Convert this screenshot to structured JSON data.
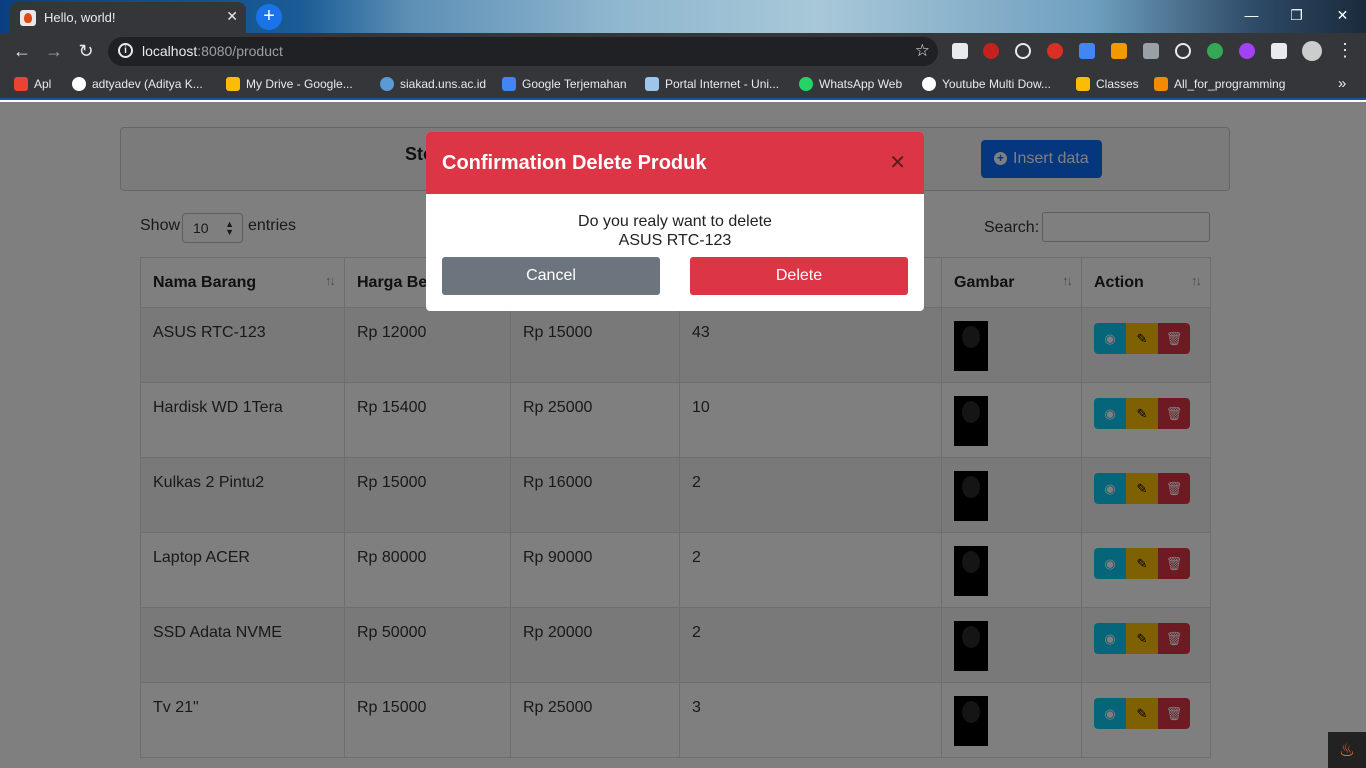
{
  "browser": {
    "tab_title": "Hello, world!",
    "tab_close": "✕",
    "new_tab": "+",
    "url_host": "localhost",
    "url_rest": ":8080/product",
    "win_min": "—",
    "win_max": "❐",
    "win_close": "✕",
    "bookmarks": [
      {
        "label": "Apl",
        "color": "#ea4335"
      },
      {
        "label": "adtyadev (Aditya K...",
        "color": "#ffffff"
      },
      {
        "label": "My Drive - Google...",
        "color": "#fbbc04"
      },
      {
        "label": "siakad.uns.ac.id",
        "color": "#5b9bd5"
      },
      {
        "label": "Google Terjemahan",
        "color": "#4285f4"
      },
      {
        "label": "Portal Internet - Uni...",
        "color": "#9fc5e8"
      },
      {
        "label": "WhatsApp Web",
        "color": "#25d366"
      },
      {
        "label": "Youtube Multi Dow...",
        "color": "#ffffff"
      },
      {
        "label": "Classes",
        "color": "#fbbc04"
      },
      {
        "label": "All_for_programming",
        "color": "#f28b00"
      }
    ],
    "more": "»"
  },
  "page": {
    "header_title": "Sto",
    "insert_label": "Insert data",
    "show_label": "Show",
    "entries_value": "10",
    "entries_label": "entries",
    "search_label": "Search:",
    "columns": [
      "Nama Barang",
      "Harga Be",
      "",
      "",
      "Gambar",
      "Action"
    ],
    "rows": [
      {
        "name": "ASUS RTC-123",
        "buy": "Rp 12000",
        "sell": "Rp 15000",
        "stock": "43"
      },
      {
        "name": "Hardisk WD 1Tera",
        "buy": "Rp 15400",
        "sell": "Rp 25000",
        "stock": "10"
      },
      {
        "name": "Kulkas 2 Pintu2",
        "buy": "Rp 15000",
        "sell": "Rp 16000",
        "stock": "2"
      },
      {
        "name": "Laptop ACER",
        "buy": "Rp 80000",
        "sell": "Rp 90000",
        "stock": "2"
      },
      {
        "name": "SSD Adata NVME",
        "buy": "Rp 50000",
        "sell": "Rp 20000",
        "stock": "2"
      },
      {
        "name": "Tv 21\"",
        "buy": "Rp 15000",
        "sell": "Rp 25000",
        "stock": "3"
      }
    ]
  },
  "modal": {
    "title": "Confirmation Delete Produk",
    "close": "✕",
    "message_line1": "Do you realy want to delete",
    "message_line2": "ASUS RTC-123",
    "cancel_label": "Cancel",
    "delete_label": "Delete"
  },
  "colors": {
    "danger": "#dc3545",
    "primary": "#0d6efd",
    "info": "#0dcaf0",
    "warning": "#ffc107",
    "secondary": "#6c757d"
  }
}
